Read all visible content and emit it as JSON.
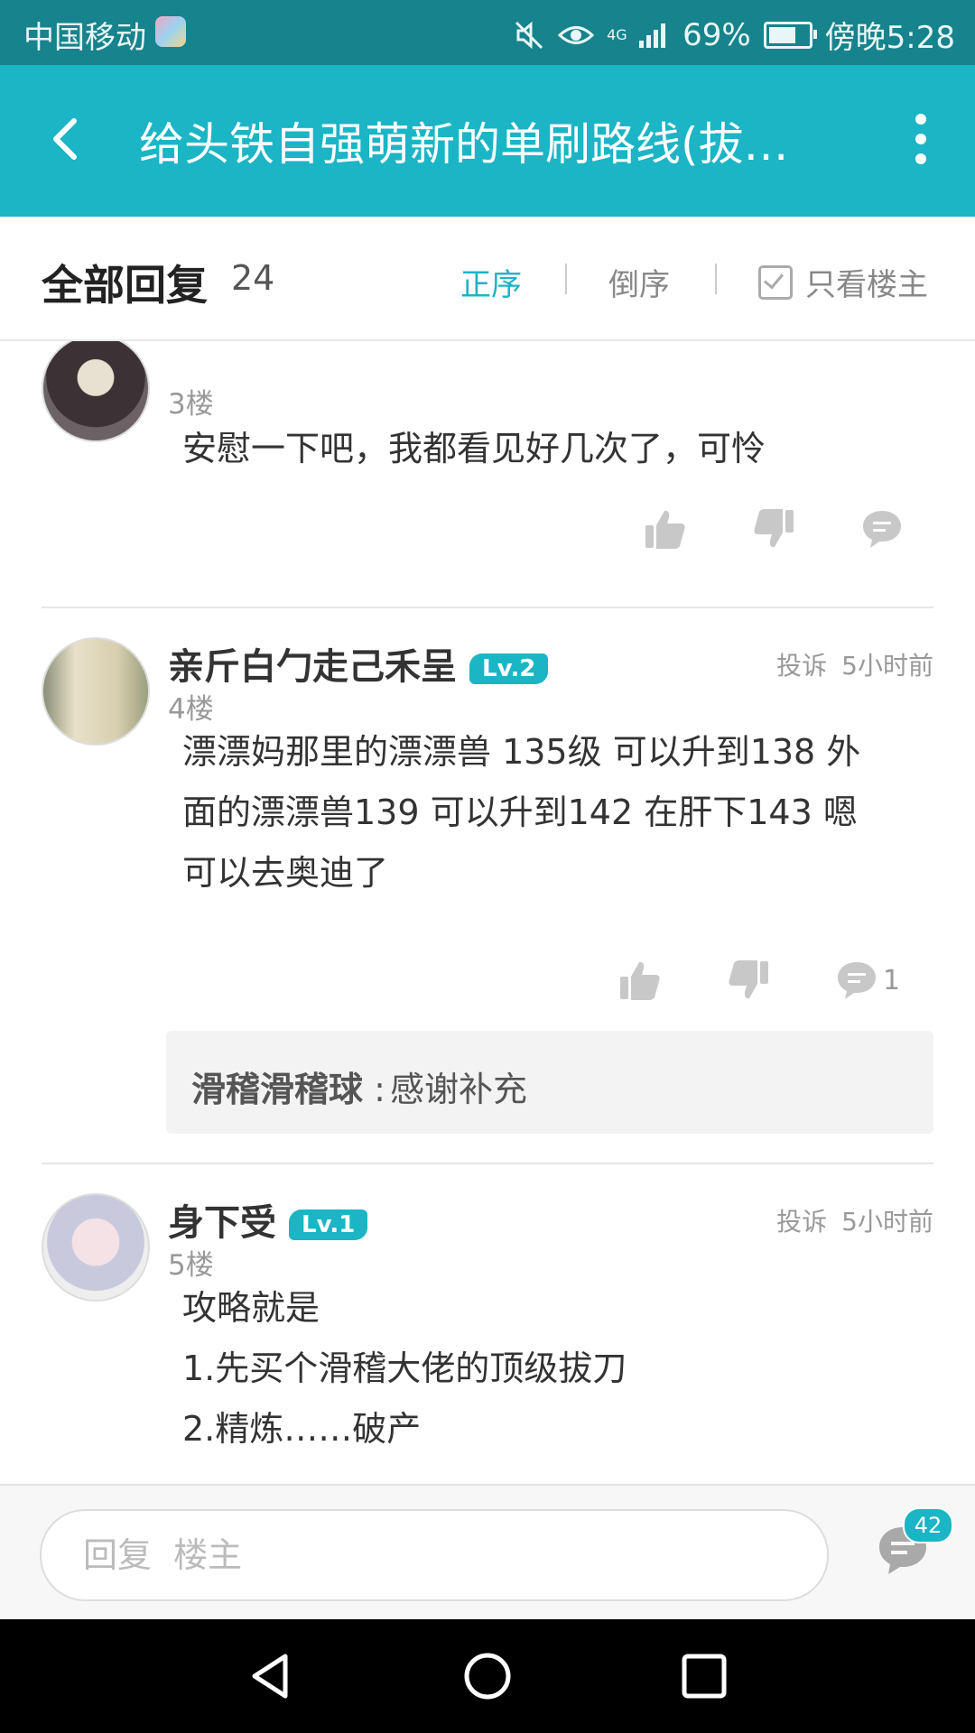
{
  "status_bar": {
    "carrier": "中国移动",
    "network": "4G",
    "battery": "69%",
    "battery_level": 0.69,
    "time": "傍晚5:28"
  },
  "app_bar": {
    "title": "给头铁自强萌新的单刷路线(拔…"
  },
  "replies_header": {
    "label": "全部回复",
    "count": "24",
    "sort_asc": "正序",
    "sort_desc": "倒序",
    "only_op": "只看楼主"
  },
  "posts": [
    {
      "floor": "3楼",
      "content": [
        "安慰一下吧，我都看见好几次了，可怜"
      ],
      "comment_count": ""
    },
    {
      "username": "亲斤白勹走己禾呈",
      "level": "Lv.2",
      "report": "投诉",
      "time": "5小时前",
      "floor": "4楼",
      "content": [
        "漂漂妈那里的漂漂兽 135级 可以升到138 外",
        "面的漂漂兽139 可以升到142 在肝下143 嗯",
        "可以去奥迪了"
      ],
      "comment_count": "1",
      "sub_reply": {
        "user": "滑稽滑稽球",
        "sep": " : ",
        "text": "感谢补充"
      }
    },
    {
      "username": "身下受",
      "level": "Lv.1",
      "report": "投诉",
      "time": "5小时前",
      "floor": "5楼",
      "content": [
        "攻略就是",
        "1.先买个滑稽大佬的顶级拔刀",
        "2.精炼……破产"
      ]
    }
  ],
  "reply_input": {
    "placeholder": "回复  楼主"
  },
  "comment_badge": "42",
  "colors": {
    "accent": "#1bb5c5",
    "status_bar": "#17838c"
  }
}
